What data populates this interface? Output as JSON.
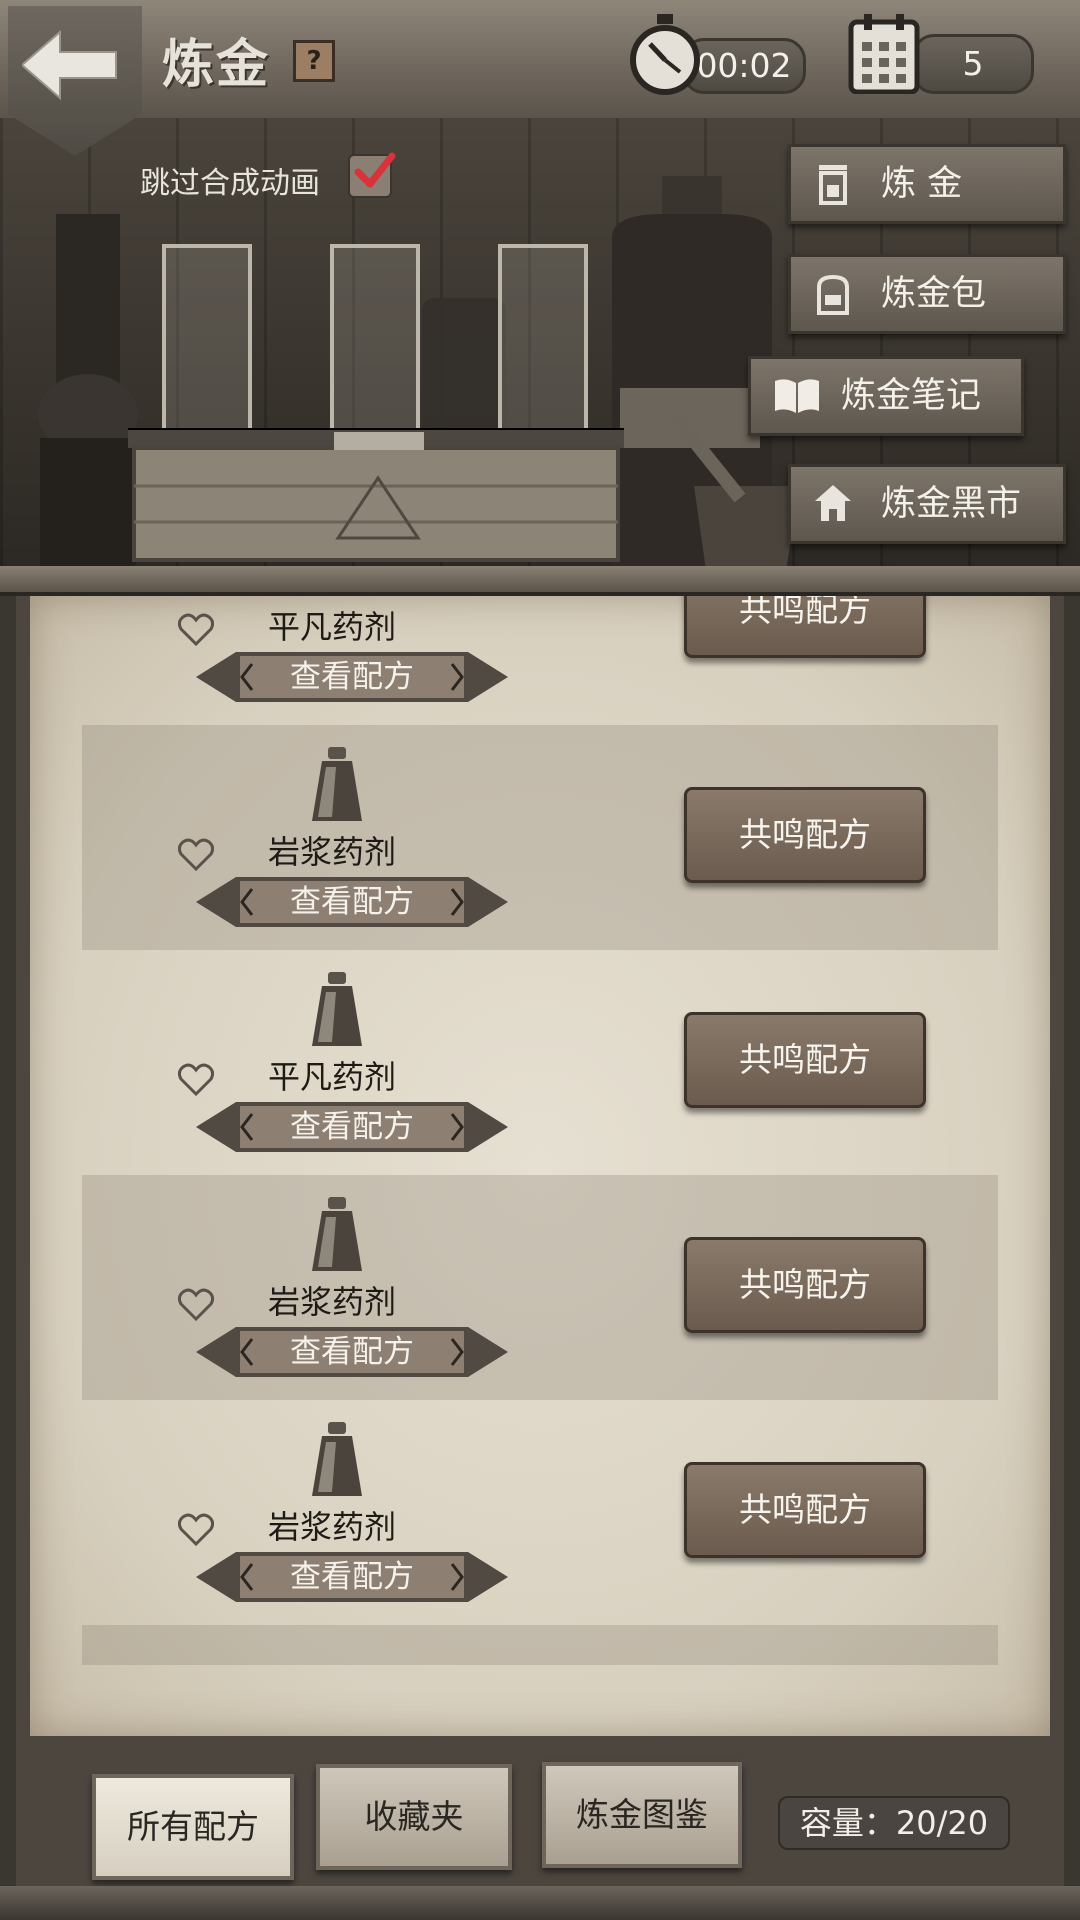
{
  "header": {
    "title": "炼金",
    "help_label": "?",
    "timer": "00:02",
    "day_count": "5"
  },
  "scene": {
    "skip_animation_label": "跳过合成动画",
    "skip_animation_checked": true,
    "side_menu": [
      {
        "label": "炼 金",
        "icon": "cauldron-icon"
      },
      {
        "label": "炼金包",
        "icon": "backpack-icon"
      },
      {
        "label": "炼金笔记",
        "icon": "book-icon"
      },
      {
        "label": "炼金黑市",
        "icon": "house-icon"
      }
    ]
  },
  "recipes": {
    "view_label": "查看配方",
    "resonate_label": "共鸣配方",
    "items": [
      {
        "name": "平凡药剂"
      },
      {
        "name": "岩浆药剂"
      },
      {
        "name": "平凡药剂"
      },
      {
        "name": "岩浆药剂"
      },
      {
        "name": "岩浆药剂"
      }
    ]
  },
  "tabs": [
    {
      "label": "所有配方",
      "active": true
    },
    {
      "label": "收藏夹",
      "active": false
    },
    {
      "label": "炼金图鉴",
      "active": false
    }
  ],
  "capacity": "容量：20/20",
  "colors": {
    "parchment": "#e0d9c9",
    "wood_button": "#7a6b5d",
    "check_red": "#d8333a"
  }
}
